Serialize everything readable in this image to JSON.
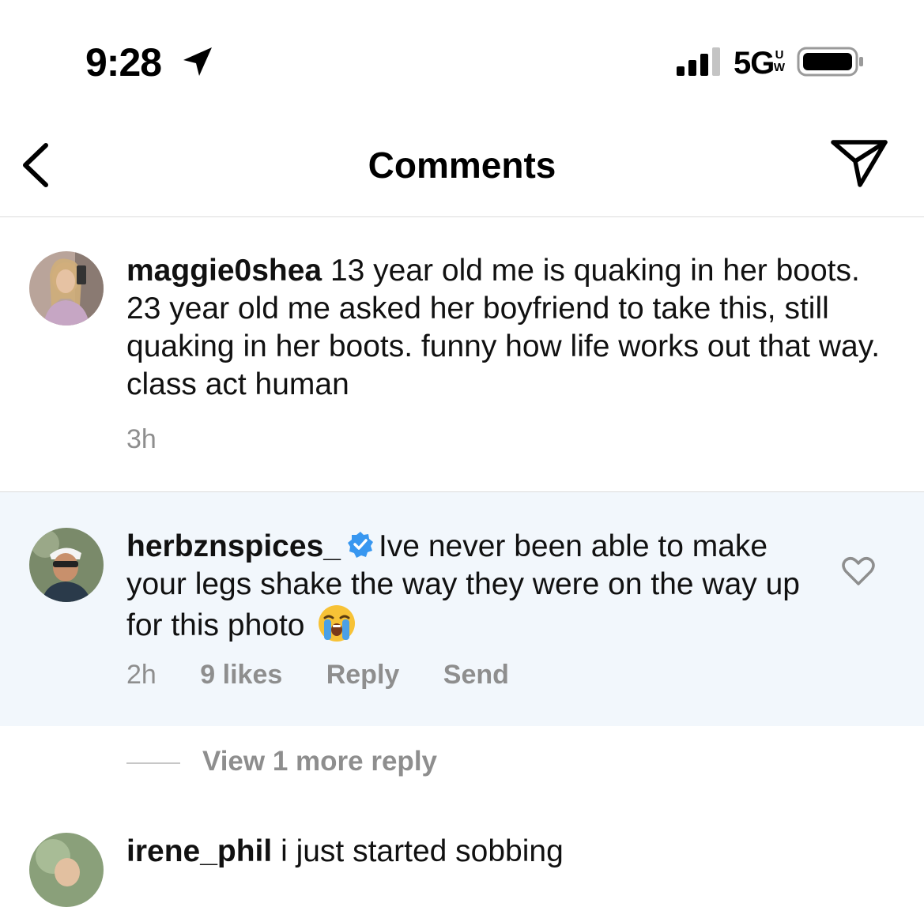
{
  "status_bar": {
    "time": "9:28",
    "network": "5G",
    "network_sup_top": "U",
    "network_sup_bottom": "W"
  },
  "header": {
    "title": "Comments"
  },
  "comments": [
    {
      "username": "maggie0shea",
      "text": " 13 year old me is quaking in her boots. 23 year old me asked her boyfriend to take this, still quaking in her boots. funny how life works out that way. class act human",
      "time": "3h"
    },
    {
      "username": "herbznspices_",
      "verified": true,
      "text": "Ive never been able to make your legs shake the way they were on the way up for this photo",
      "emoji": "loudly-crying-face",
      "time": "2h",
      "likes": "9 likes",
      "reply_label": "Reply",
      "send_label": "Send"
    },
    {
      "username": "irene_phil",
      "text": " i just started sobbing"
    }
  ],
  "view_more": {
    "label": "View 1 more reply"
  },
  "colors": {
    "highlight_bg": "#f2f7fc",
    "meta_text": "#8e8e8e",
    "verified_blue": "#3897f0"
  }
}
